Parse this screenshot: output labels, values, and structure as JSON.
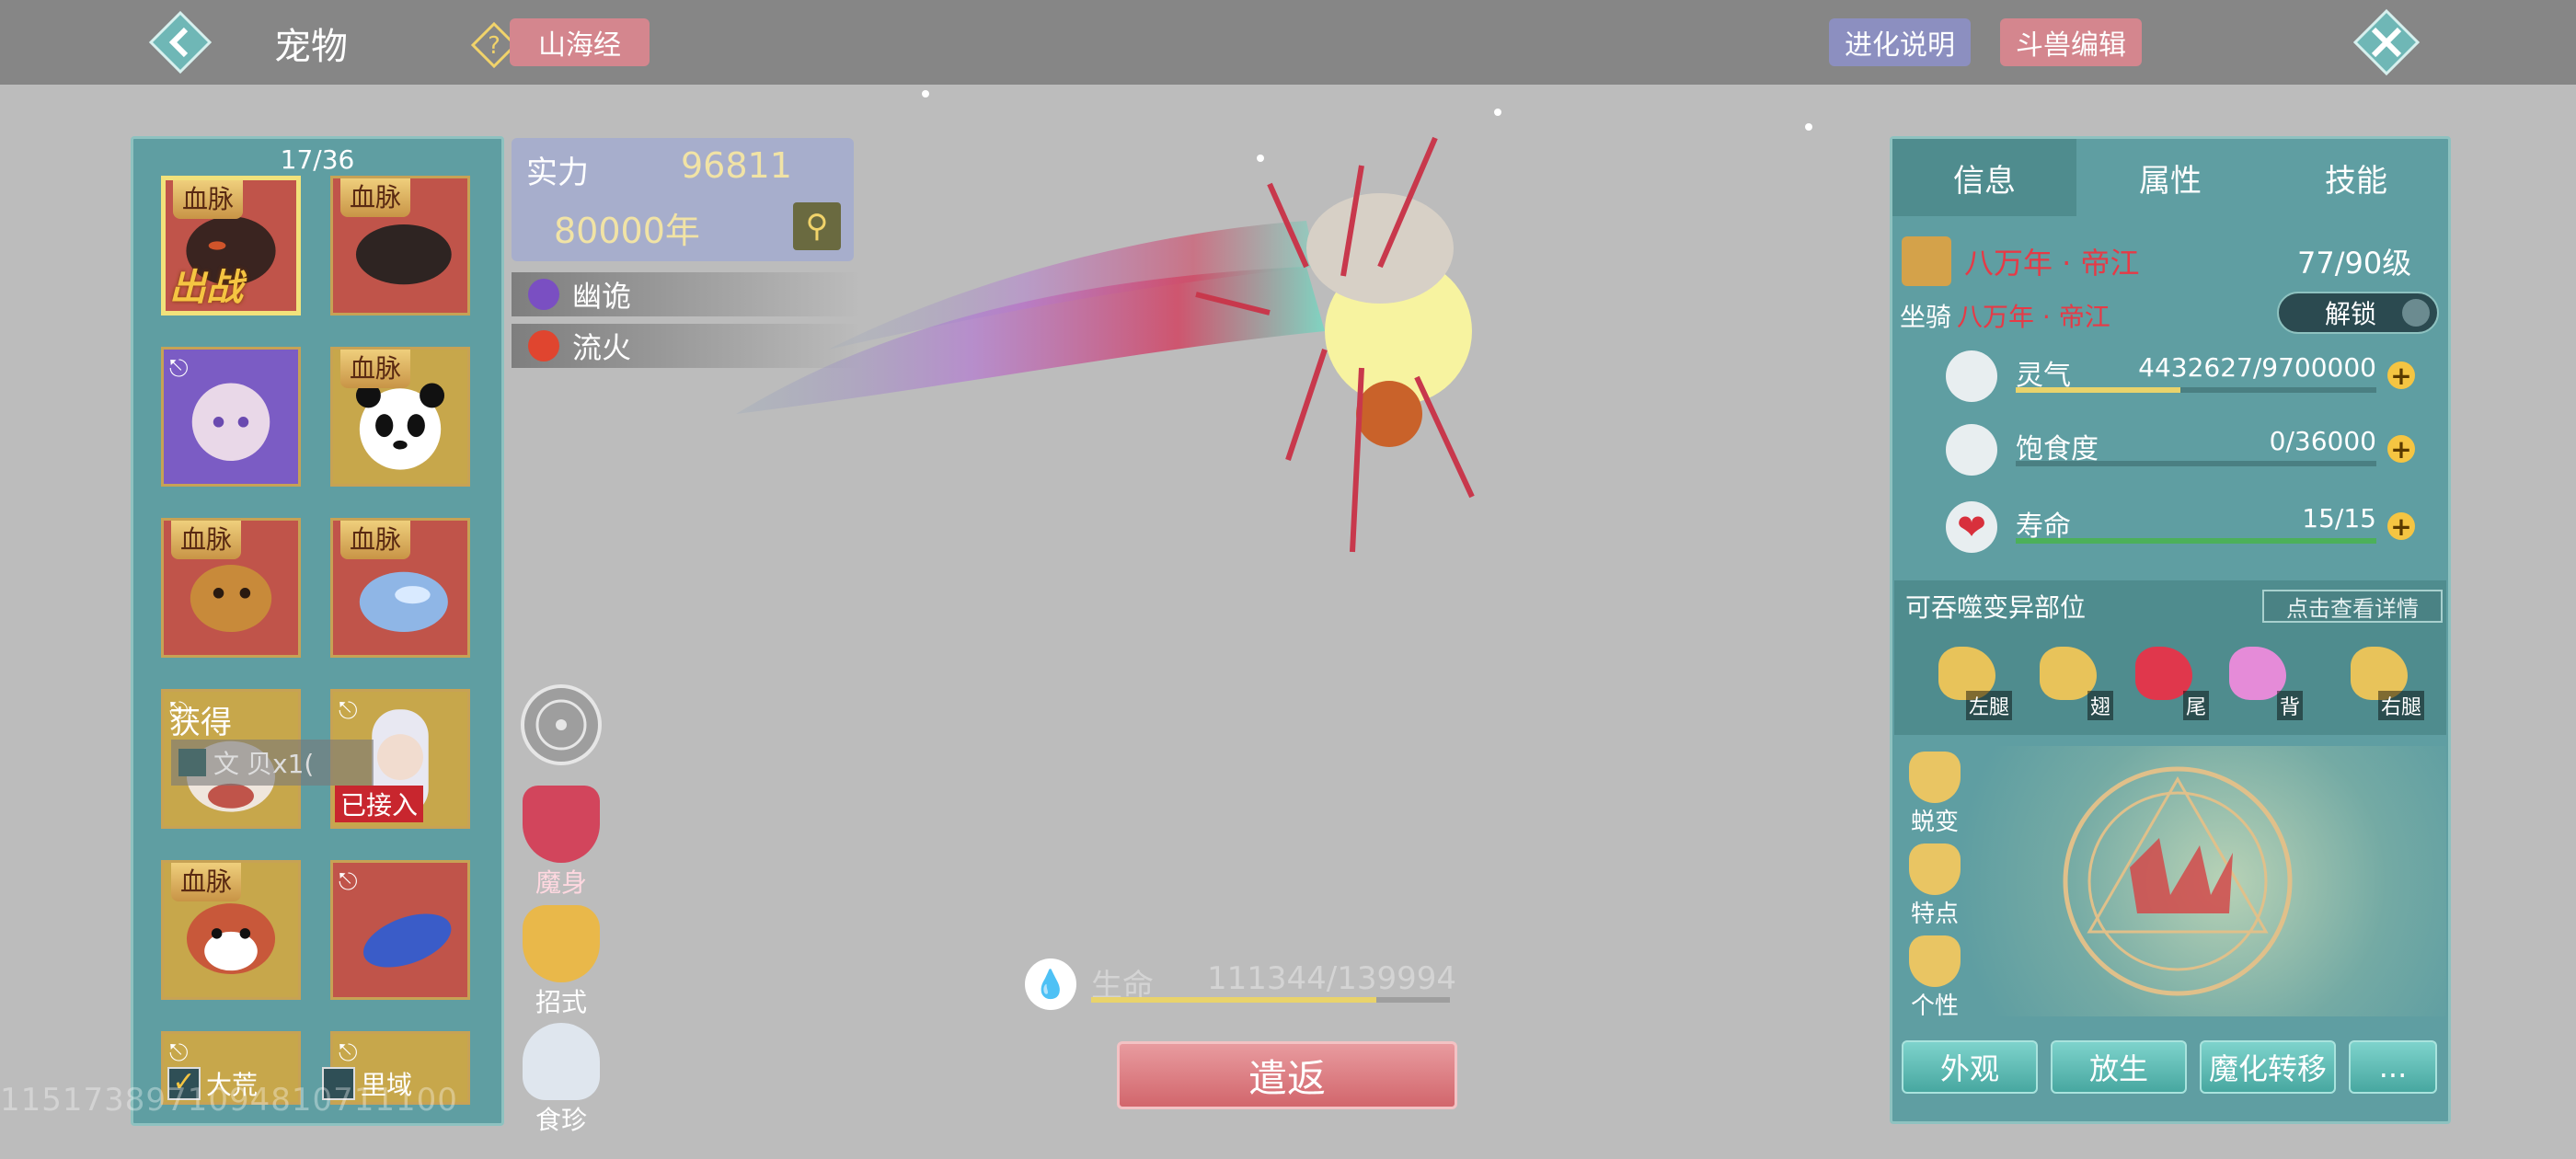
{
  "header": {
    "title": "宠物",
    "shanhaijing_label": "山海经",
    "evolution_help_label": "进化说明",
    "beast_edit_label": "斗兽编辑"
  },
  "pet_list": {
    "count": "17/36",
    "bloodline_tag": "血脉",
    "deployed_tag": "出战",
    "connected_tag": "已接入",
    "filters": [
      {
        "label": "大荒",
        "checked": true
      },
      {
        "label": "里域",
        "checked": false
      }
    ]
  },
  "toast": {
    "title": "获得",
    "item_text": "贝x1(",
    "item_prefix": "文"
  },
  "stats": {
    "power_label": "实力",
    "power_value": "96811",
    "age": "80000年",
    "traits": [
      {
        "label": "幽诡",
        "color": "#7a4fc2"
      },
      {
        "label": "流火",
        "color": "#e0452f"
      }
    ]
  },
  "center_buttons": {
    "demon_form": "魔身",
    "moves": "招式",
    "food": "食珍"
  },
  "hp": {
    "label": "生命",
    "value": "111344/139994",
    "fraction": 0.795
  },
  "dismiss_label": "遣返",
  "info_panel": {
    "tabs": [
      "信息",
      "属性",
      "技能"
    ],
    "active_tab": 0,
    "pet_name": "八万年 · 帝江",
    "level": "77/90级",
    "mount_label": "坐骑",
    "mount_name": "八万年 · 帝江",
    "unlock_label": "解锁",
    "bars": [
      {
        "label": "灵气",
        "value": "4432627/9700000",
        "fraction": 0.457,
        "color": "#e9d36b"
      },
      {
        "label": "饱食度",
        "value": "0/36000",
        "fraction": 0.0,
        "color": "#e9d36b"
      },
      {
        "label": "寿命",
        "value": "15/15",
        "fraction": 1.0,
        "color": "#4cb05a"
      }
    ],
    "mutation_title": "可吞噬变异部位",
    "mutation_detail": "点击查看详情",
    "parts": [
      {
        "tag": "左腿",
        "color": "#e8c35a"
      },
      {
        "tag": "翅",
        "color": "#e8c35a"
      },
      {
        "tag": "尾",
        "color": "#e0374c"
      },
      {
        "tag": "背",
        "color": "#e58bd8"
      },
      {
        "tag": "右腿",
        "color": "#e8c35a"
      }
    ],
    "side_buttons": [
      "蜕变",
      "特点",
      "个性"
    ],
    "actions": [
      "外观",
      "放生",
      "魔化转移",
      "..."
    ]
  },
  "watermark": "1151738971094810711100"
}
